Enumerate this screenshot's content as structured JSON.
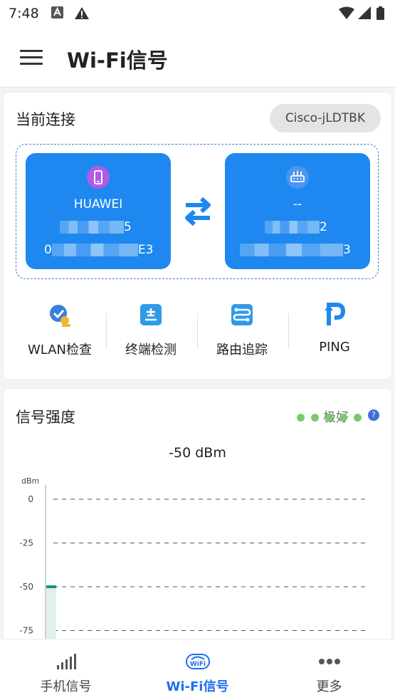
{
  "status_bar": {
    "time": "7:48"
  },
  "app_bar": {
    "title": "Wi-Fi信号"
  },
  "connection": {
    "title": "当前连接",
    "ssid": "Cisco-jLDTBK",
    "device": {
      "name": "HUAWEI",
      "line1_end": "5",
      "line2_start": "0",
      "line2_end": "E3"
    },
    "router": {
      "name": "--",
      "line1_end": "2",
      "line2_end": "3"
    }
  },
  "tools": [
    {
      "label": "WLAN检查",
      "icon": "wlan-check-icon"
    },
    {
      "label": "终端检测",
      "icon": "terminal-detect-icon"
    },
    {
      "label": "路由追踪",
      "icon": "route-trace-icon"
    },
    {
      "label": "PING",
      "icon": "ping-icon"
    }
  ],
  "signal": {
    "title": "信号强度",
    "quality": "极好",
    "quality_level": 5,
    "value_text": "-50  dBm",
    "chart": {
      "unit": "dBm",
      "y_ticks": [
        "0",
        "-25",
        "-50",
        "-75"
      ],
      "ylim": [
        -75,
        0
      ],
      "current": -50
    }
  },
  "colors": {
    "accent": "#1e88f0",
    "good": "#7cc96b",
    "teal": "#1f8f82"
  },
  "bottom_nav": [
    {
      "label": "手机信号",
      "icon": "cell-signal-icon"
    },
    {
      "label": "Wi-Fi信号",
      "icon": "wifi-badge-icon",
      "active": true
    },
    {
      "label": "更多",
      "icon": "more-icon"
    }
  ]
}
